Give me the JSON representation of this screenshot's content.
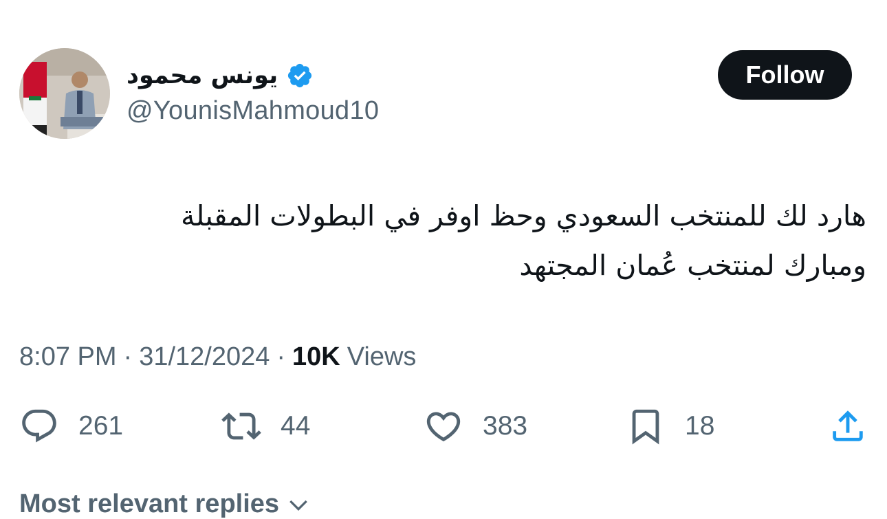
{
  "author": {
    "display_name": "يونس محمود",
    "handle": "@YounisMahmoud10",
    "verified": true,
    "avatar_icon": "profile-photo"
  },
  "follow_label": "Follow",
  "tweet": {
    "lines": [
      "هارد لك للمنتخب السعودي وحظ اوفر في البطولات المقبلة",
      "ومبارك لمنتخب عُمان المجتهد"
    ]
  },
  "meta": {
    "time": "8:07 PM",
    "separator": "·",
    "date": "31/12/2024",
    "views_count": "10K",
    "views_label": "Views"
  },
  "actions": {
    "reply": {
      "icon": "reply-icon",
      "count": "261"
    },
    "retweet": {
      "icon": "retweet-icon",
      "count": "44"
    },
    "like": {
      "icon": "heart-icon",
      "count": "383"
    },
    "bookmark": {
      "icon": "bookmark-icon",
      "count": "18"
    },
    "share": {
      "icon": "share-icon"
    }
  },
  "replies_header": "Most relevant replies",
  "colors": {
    "text": "#0f1419",
    "muted": "#536471",
    "verified": "#1d9bf0",
    "button_bg": "#0f1419"
  }
}
